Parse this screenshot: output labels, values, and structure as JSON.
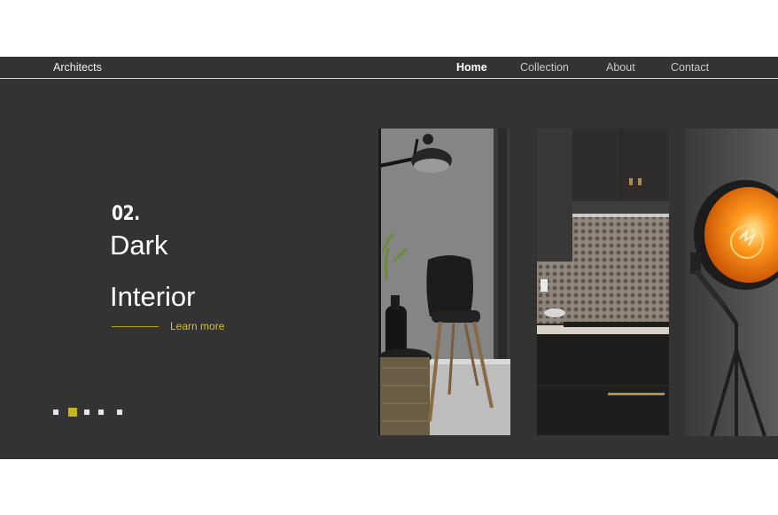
{
  "brand": "Architects",
  "nav": {
    "items": [
      {
        "label": "Home",
        "active": true
      },
      {
        "label": "Collection",
        "active": false
      },
      {
        "label": "About",
        "active": false
      },
      {
        "label": "Contact",
        "active": false
      }
    ]
  },
  "hero": {
    "number": "02.",
    "title_line1": "Dark",
    "title_line2": "Interior",
    "cta_label": "Learn more"
  },
  "slider": {
    "dots": 5,
    "active_index": 1
  },
  "gallery": {
    "images": [
      "chair-photo",
      "kitchen-photo",
      "lamp-photo"
    ]
  },
  "colors": {
    "background": "#333333",
    "accent": "#c7b41c",
    "text": "#ffffff"
  }
}
